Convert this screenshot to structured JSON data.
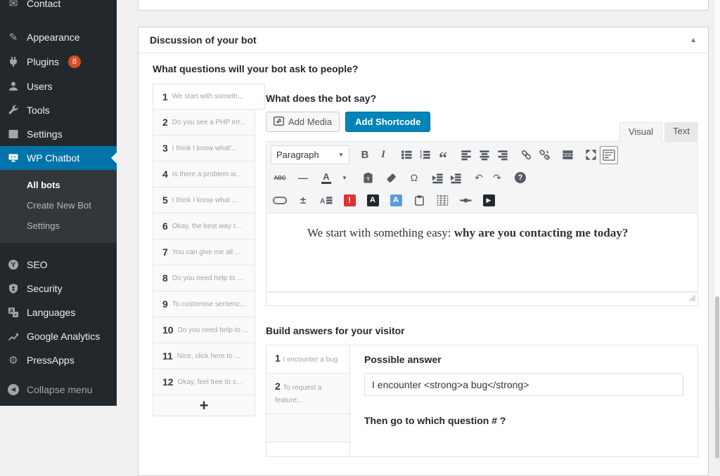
{
  "colors": {
    "accent_blue": "#0073aa",
    "primary_button": "#0085ba",
    "badge": "#d54e21",
    "alert_red": "#dc3232"
  },
  "sidebar": {
    "items": [
      {
        "label": "Contact"
      },
      {
        "label": "Appearance"
      },
      {
        "label": "Plugins",
        "badge": "8"
      },
      {
        "label": "Users"
      },
      {
        "label": "Tools"
      },
      {
        "label": "Settings"
      },
      {
        "label": "WP Chatbot"
      }
    ],
    "submenu": [
      {
        "label": "All bots"
      },
      {
        "label": "Create New Bot"
      },
      {
        "label": "Settings"
      }
    ],
    "lower": [
      {
        "label": "SEO"
      },
      {
        "label": "Security"
      },
      {
        "label": "Languages"
      },
      {
        "label": "Google Analytics"
      },
      {
        "label": "PressApps"
      }
    ],
    "collapse_label": "Collapse menu"
  },
  "panel": {
    "title": "Discussion of your bot",
    "collapse_icon": "▲",
    "questions_heading": "What questions will your bot ask to people?",
    "questions": [
      {
        "n": "1",
        "text": "We start with someth..."
      },
      {
        "n": "2",
        "text": "Do you see a PHP err..."
      },
      {
        "n": "3",
        "text": "I think I know what'..."
      },
      {
        "n": "4",
        "text": "Is there a problem w..."
      },
      {
        "n": "5",
        "text": "I think I know what ..."
      },
      {
        "n": "6",
        "text": "Okay, the best way t..."
      },
      {
        "n": "7",
        "text": "You can give me all ..."
      },
      {
        "n": "8",
        "text": "Do you need help to ..."
      },
      {
        "n": "9",
        "text": "To customise sentenc..."
      },
      {
        "n": "10",
        "text": "Do you need help to ..."
      },
      {
        "n": "11",
        "text": "Nice, click here to ..."
      },
      {
        "n": "12",
        "text": "Okay, feel free to s..."
      }
    ],
    "add_question_label": "+"
  },
  "editor": {
    "heading": "What does the bot say?",
    "add_media_label": "Add Media",
    "add_shortcode_label": "Add Shortcode",
    "visual_tab": "Visual",
    "text_tab": "Text",
    "paragraph_label": "Paragraph",
    "content": {
      "normal": "We start with something easy: ",
      "bold": "why are you contacting me today?"
    }
  },
  "answers": {
    "heading": "Build answers for your visitor",
    "items": [
      {
        "n": "1",
        "text": "I encounter a bug"
      },
      {
        "n": "2",
        "text": "To request a feature..."
      }
    ],
    "possible_answer_label": "Possible answer",
    "answer_value": "I encounter <strong>a bug</strong>",
    "next_question_label": "Then go to which question # ?"
  },
  "icons": {
    "envelope": "✉",
    "pencil": "✎",
    "gear": "⚙",
    "collapse_arrow": "◀",
    "bold": "B",
    "italic": "I",
    "quote": "“",
    "strike": "ABC",
    "hr": "—",
    "color_letter": "A",
    "omega": "Ω",
    "undo": "↶",
    "redo": "↷",
    "help": "?",
    "plusminus": "±",
    "alert": "!",
    "letter_a": "A",
    "play": "▶",
    "caret_down": "▼",
    "yoast_y": "Y"
  }
}
